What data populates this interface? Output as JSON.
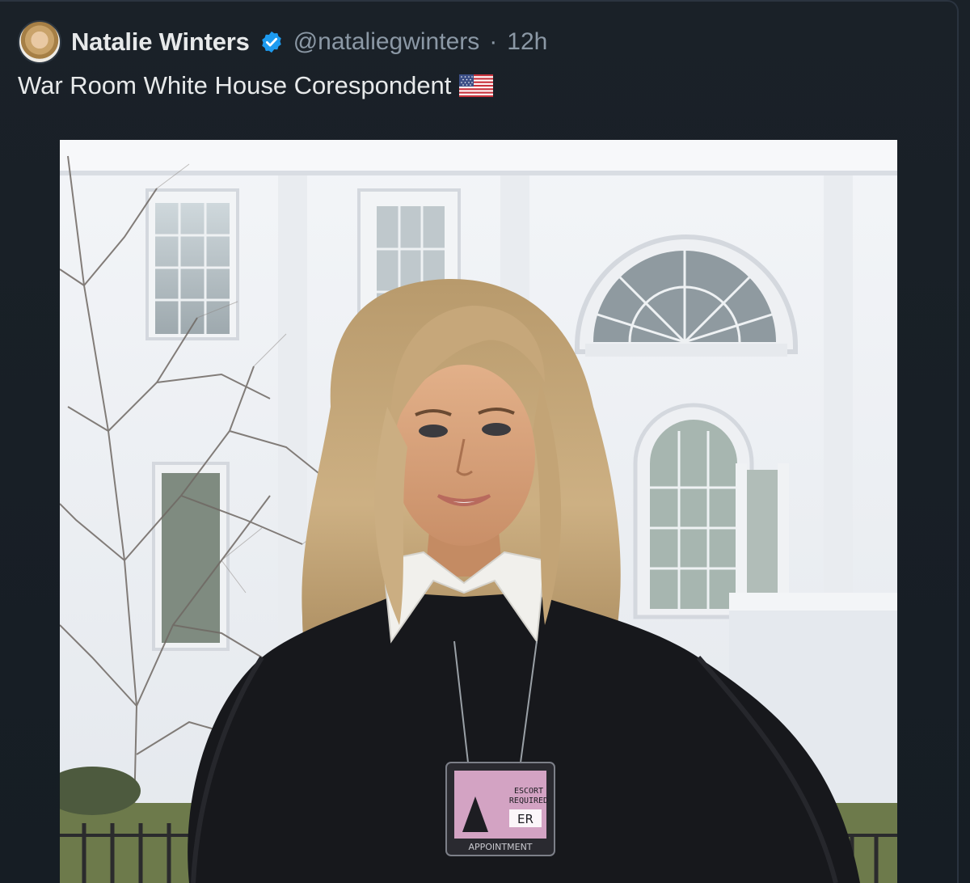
{
  "tweet": {
    "author_name": "Natalie Winters",
    "handle": "@nataliegwinters",
    "separator": "·",
    "time": "12h",
    "text": "War Room White House Corespondent",
    "verified": true,
    "emoji": "flag-us"
  },
  "media": {
    "badge": {
      "lines": [
        "ESCORT",
        "REQUIRED"
      ],
      "letters": "ER",
      "bottom": "APPOINTMENT"
    }
  },
  "colors": {
    "background": "#161d24",
    "name": "#e7e9ea",
    "secondary": "#8b98a5",
    "verified_blue": "#1d9bf0"
  }
}
